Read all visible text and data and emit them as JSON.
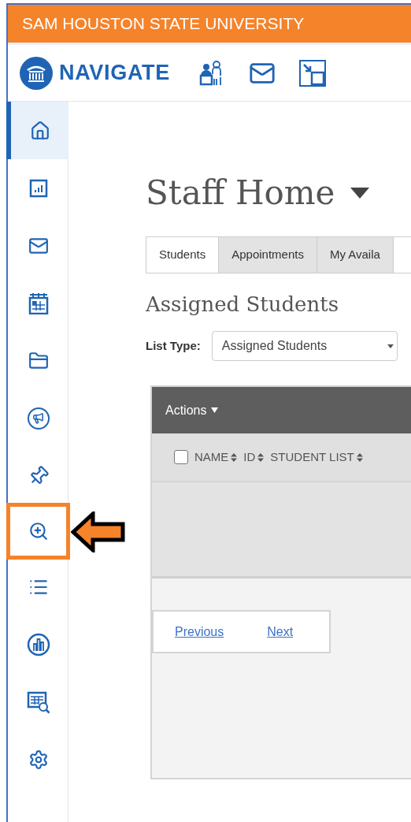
{
  "banner": {
    "title": "SAM HOUSTON STATE UNIVERSITY"
  },
  "header": {
    "logo_text": "NAVIGATE"
  },
  "sidebar": {
    "items": [
      {
        "selected": true,
        "highlighted": false
      },
      {
        "selected": false,
        "highlighted": false
      },
      {
        "selected": false,
        "highlighted": false
      },
      {
        "selected": false,
        "highlighted": false
      },
      {
        "selected": false,
        "highlighted": false
      },
      {
        "selected": false,
        "highlighted": false
      },
      {
        "selected": false,
        "highlighted": false
      },
      {
        "selected": false,
        "highlighted": true
      },
      {
        "selected": false,
        "highlighted": false
      },
      {
        "selected": false,
        "highlighted": false
      },
      {
        "selected": false,
        "highlighted": false
      },
      {
        "selected": false,
        "highlighted": false
      }
    ]
  },
  "page": {
    "title": "Staff Home"
  },
  "tabs": [
    {
      "label": "Students",
      "selected": true
    },
    {
      "label": "Appointments",
      "selected": false
    },
    {
      "label": "My Availa",
      "selected": false
    }
  ],
  "section": {
    "title": "Assigned Students"
  },
  "list_type": {
    "label": "List Type:",
    "value": "Assigned Students"
  },
  "table": {
    "actions": "Actions",
    "select_all": {
      "checked": false
    },
    "columns": [
      "NAME",
      "ID",
      "STUDENT LIST"
    ]
  },
  "pagination": {
    "previous": "Previous",
    "next": "Next"
  }
}
